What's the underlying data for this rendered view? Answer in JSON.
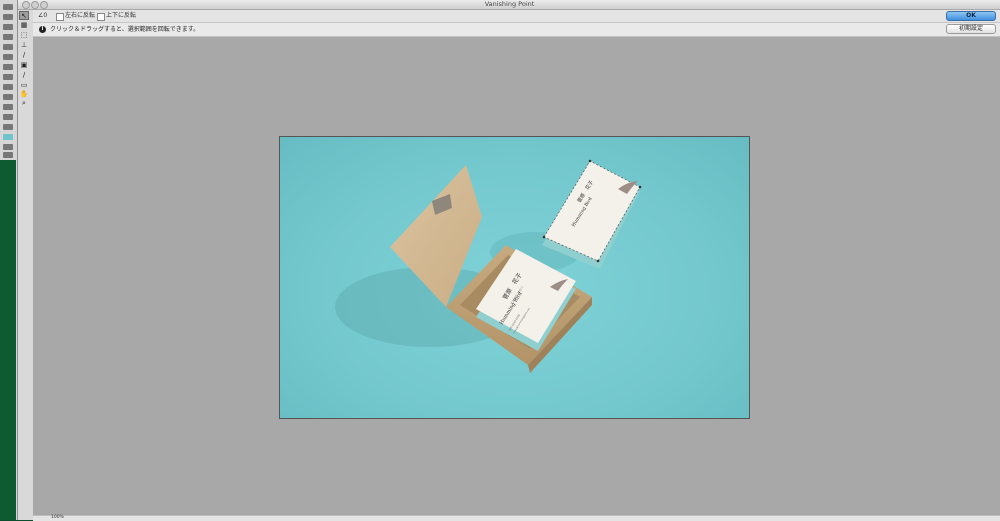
{
  "window": {
    "title": "Vanishing Point"
  },
  "options": {
    "angle_label": "∠0",
    "flip_horizontal": "左右に反転",
    "flip_vertical": "上下に反転"
  },
  "info": {
    "text": "クリック＆ドラッグすると、選択範囲を回転できます。"
  },
  "buttons": {
    "ok": "OK",
    "reset": "初期設定"
  },
  "status": {
    "zoom": "100%"
  },
  "photo": {
    "description_colors": {
      "background": "#78cdd2",
      "box": "#d2b892",
      "card": "#f4f1ea"
    },
    "card_text": {
      "furigana": "すがはら はなこ",
      "name": "菅原　花子",
      "brand": "Humming Bird",
      "address": "000-0000-0000",
      "email": "xxxx@hummingbird.xxx"
    }
  },
  "colors": {
    "ok_button": "#4a97e6",
    "canvas": "#a8a8a8",
    "dialog": "#d9d9d9"
  }
}
